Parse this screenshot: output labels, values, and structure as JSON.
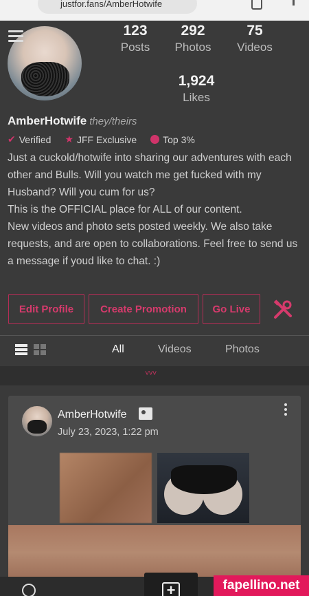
{
  "browser": {
    "url": "justfor.fans/AmberHotwife"
  },
  "profile": {
    "username": "AmberHotwife",
    "pronouns": "they/theirs",
    "stats": {
      "posts": {
        "value": "123",
        "label": "Posts"
      },
      "photos": {
        "value": "292",
        "label": "Photos"
      },
      "videos": {
        "value": "75",
        "label": "Videos"
      },
      "likes": {
        "value": "1,924",
        "label": "Likes"
      }
    },
    "badges": {
      "verified": "Verified",
      "exclusive": "JFF Exclusive",
      "top": "Top 3%"
    },
    "bio": {
      "line1": "Just a cuckold/hotwife into sharing our adventures with each other and Bulls. Will you watch me get fucked with my Husband? Will you cum for us?",
      "line2": "This is the OFFICIAL place for ALL of our content.",
      "line3": "New videos and photo sets posted weekly. We also take requests, and are open to collaborations. Feel free to send us a message if youd like to chat. :)"
    }
  },
  "actions": {
    "edit": "Edit Profile",
    "promo": "Create Promotion",
    "live": "Go Live"
  },
  "tabs": {
    "all": "All",
    "videos": "Videos",
    "photos": "Photos"
  },
  "loader": "˅˅˅",
  "post": {
    "author": "AmberHotwife",
    "date": "July 23, 2023, 1:22 pm"
  },
  "watermark": "fapellino.net",
  "colors": {
    "accent": "#d63a6c",
    "background": "#3a3a3a"
  }
}
